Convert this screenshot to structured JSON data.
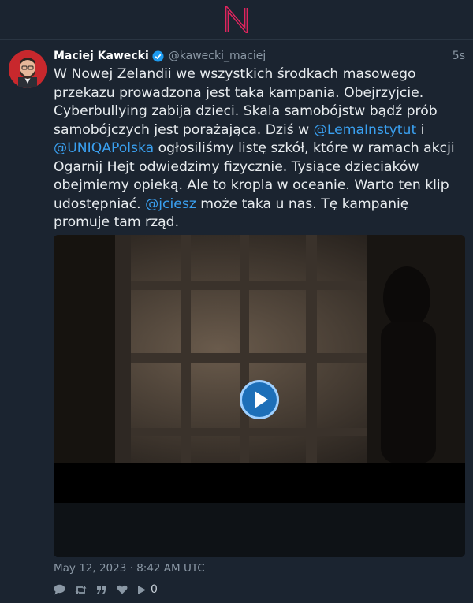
{
  "app": {
    "logo_icon": "n-logo-icon",
    "accent": "#e0245e"
  },
  "tweet": {
    "author_name": "Maciej Kawecki",
    "handle": "@kawecki_maciej",
    "relative_time": "5s",
    "verified_color": "#1d9bf0",
    "text_parts": [
      "W Nowej Zelandii we wszystkich środkach masowego przekazu prowadzona jest taka kampania. Obejrzyjcie. Cyberbullying zabija dzieci. Skala samobójstw bądź prób samobójczych jest porażająca. Dziś w ",
      "@LemaInstytut",
      " i ",
      "@UNIQAPolska",
      " ogłosiliśmy listę szkół, które w ramach akcji Ogarnij Hejt odwiedzimy fizycznie. Tysiące dzieciaków obejmiemy opieką. Ale to kropla w oceanie. Warto ten klip udostępniać. ",
      "@jciesz",
      " może taka u nas. Tę kampanię promuje tam rząd."
    ],
    "timestamp": "May 12, 2023 · 8:42 AM UTC",
    "media": {
      "type": "video",
      "play_icon": "play-icon"
    },
    "actions": {
      "reply_icon": "comment-icon",
      "retweet_icon": "retweet-icon",
      "quote_icon": "quote-icon",
      "like_icon": "heart-icon",
      "views_icon": "play-views-icon",
      "views_count": "0"
    }
  }
}
